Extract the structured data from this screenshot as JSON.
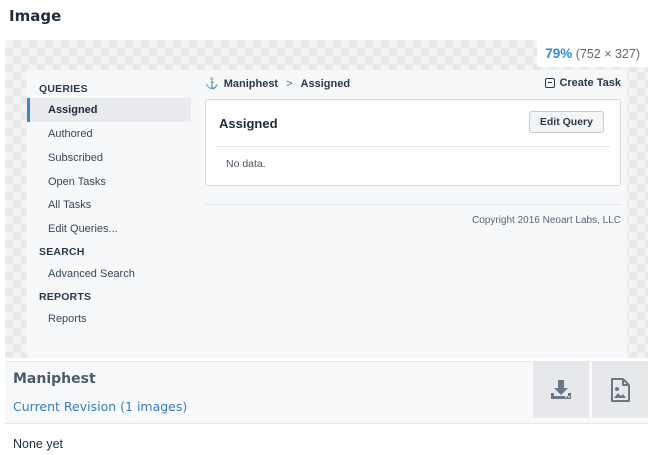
{
  "page": {
    "title": "Image"
  },
  "zoom": {
    "percent": "79%",
    "dimensions": "(752 × 327)"
  },
  "screenshot": {
    "sidebar": {
      "queries_heading": "QUERIES",
      "queries": [
        "Assigned",
        "Authored",
        "Subscribed",
        "Open Tasks",
        "All Tasks",
        "Edit Queries..."
      ],
      "search_heading": "SEARCH",
      "search_items": [
        "Advanced Search"
      ],
      "reports_heading": "REPORTS",
      "reports_items": [
        "Reports"
      ]
    },
    "breadcrumb": {
      "app": "Maniphest",
      "separator": ">",
      "current": "Assigned"
    },
    "create_task": "Create Task",
    "panel": {
      "title": "Assigned",
      "edit_button": "Edit Query",
      "empty": "No data."
    },
    "copyright": "Copyright 2016 Neoart Labs, LLC"
  },
  "file_info": {
    "name": "Maniphest",
    "revision": "Current Revision (1 images)"
  },
  "actions": [
    {
      "name": "download-icon"
    },
    {
      "name": "image-view-icon"
    }
  ],
  "comments": {
    "status": "None yet"
  },
  "colors": {
    "accent": "#3a86d1",
    "link": "#3a7cbf",
    "zoom": "#2f8ad1"
  }
}
